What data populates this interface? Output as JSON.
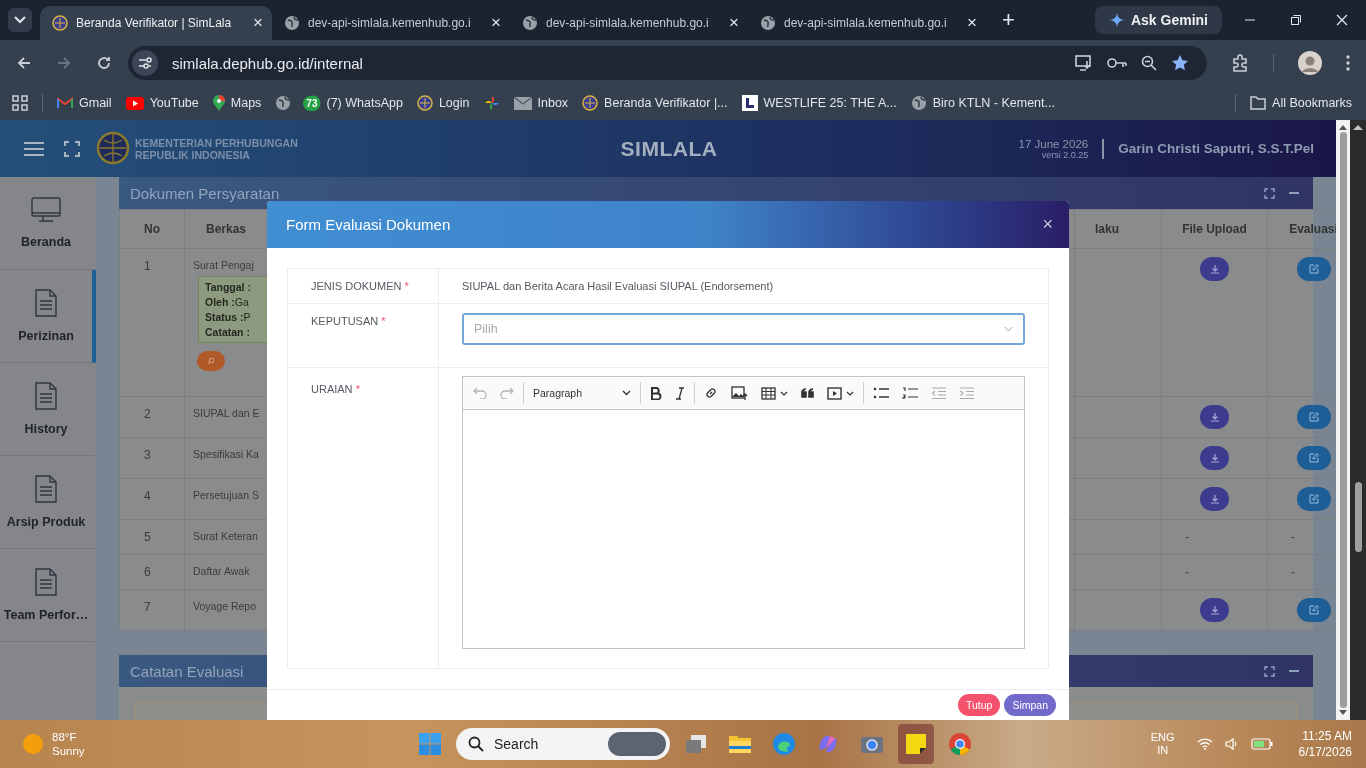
{
  "browser": {
    "tabs": [
      {
        "title": "Beranda Verifikator | SimLala",
        "selected": true,
        "close": "×"
      },
      {
        "title": "dev-api-simlala.kemenhub.go.i",
        "selected": false,
        "close": "×"
      },
      {
        "title": "dev-api-simlala.kemenhub.go.i",
        "selected": false,
        "close": "×"
      },
      {
        "title": "dev-api-simlala.kemenhub.go.i",
        "selected": false,
        "close": "×"
      }
    ],
    "new_tab": "+",
    "gemini": "Ask Gemini",
    "url": "simlala.dephub.go.id/internal",
    "bookmarks": [
      {
        "kind": "link",
        "label": "Gmail"
      },
      {
        "kind": "link",
        "label": "YouTube"
      },
      {
        "kind": "link",
        "label": "Maps"
      },
      {
        "kind": "icon"
      },
      {
        "kind": "link",
        "label": "(7) WhatsApp",
        "badge": "73"
      },
      {
        "kind": "link",
        "label": "Login"
      },
      {
        "kind": "icon"
      },
      {
        "kind": "link",
        "label": "Inbox"
      },
      {
        "kind": "link",
        "label": "Beranda Verifikator |..."
      },
      {
        "kind": "link",
        "label": "WESTLIFE 25: THE A..."
      },
      {
        "kind": "link",
        "label": "Biro KTLN - Kement..."
      }
    ],
    "all_bookmarks": "All Bookmarks"
  },
  "app": {
    "org_line1": "KEMENTERIAN PERHUBUNGAN",
    "org_line2": "REPUBLIK INDONESIA",
    "title": "SIMLALA",
    "date": "17 June 2026",
    "version": "versi 2.0.25",
    "user": "Garin Christi Saputri, S.S.T.Pel",
    "sidebar": [
      {
        "label": "Beranda",
        "selected": false
      },
      {
        "label": "Perizinan",
        "selected": true
      },
      {
        "label": "History",
        "selected": false
      },
      {
        "label": "Arsip Produk",
        "selected": false
      },
      {
        "label": "Team Perfor…",
        "selected": false
      }
    ],
    "documents": {
      "title": "Dokumen Persyaratan",
      "columns": [
        "No",
        "Berkas",
        "laku",
        "File Upload",
        "Evaluasi"
      ],
      "rows": [
        {
          "no": "1",
          "berkas": "Surat Pengaj",
          "note": [
            {
              "label": "Tanggal :"
            },
            {
              "label": "Oleh :",
              "value": "Ga"
            },
            {
              "label": "Status :",
              "value": "P"
            },
            {
              "label": "Catatan :"
            }
          ],
          "search": true,
          "file_upload": {
            "kind": "download"
          },
          "evaluasi": {
            "kind": "edit"
          }
        },
        {
          "no": "2",
          "berkas": "SIUPAL dan E",
          "file_upload": {
            "kind": "download"
          },
          "evaluasi": {
            "kind": "edit"
          }
        },
        {
          "no": "3",
          "berkas": "Spesifikasi Ka",
          "file_upload": {
            "kind": "download"
          },
          "evaluasi": {
            "kind": "edit"
          }
        },
        {
          "no": "4",
          "berkas": "Persetujuan S",
          "file_upload": {
            "kind": "download"
          },
          "evaluasi": {
            "kind": "edit"
          }
        },
        {
          "no": "5",
          "berkas": "Surat Keteran",
          "file_upload": {
            "kind": "text",
            "text": "-"
          },
          "evaluasi": {
            "kind": "text",
            "text": "-"
          }
        },
        {
          "no": "6",
          "berkas": "Daftar Awak",
          "file_upload": {
            "kind": "text",
            "text": "-"
          },
          "evaluasi": {
            "kind": "text",
            "text": "-"
          }
        },
        {
          "no": "7",
          "berkas": "Voyage Repo",
          "file_upload": {
            "kind": "download"
          },
          "evaluasi": {
            "kind": "edit"
          }
        }
      ]
    },
    "evaluation": {
      "title": "Catatan Evaluasi"
    }
  },
  "modal": {
    "title": "Form Evaluasi Dokumen",
    "close": "×",
    "fields": [
      {
        "kind": "text",
        "label": "JENIS DOKUMEN",
        "required_mark": "*",
        "value": "SIUPAL dan Berita Acara Hasil Evaluasi SIUPAL (Endorsement)"
      },
      {
        "kind": "select",
        "label": "KEPUTUSAN",
        "required_mark": "*",
        "placeholder": "Pilih",
        "focused": true
      },
      {
        "kind": "editor",
        "label": "URAIAN",
        "required_mark": "*",
        "block_format": "Paragraph"
      }
    ],
    "buttons": [
      {
        "label": "Tutup",
        "kind": "cancel"
      },
      {
        "label": "Simpan",
        "kind": "save"
      }
    ]
  },
  "taskbar": {
    "temperature": "88°F",
    "condition": "Sunny",
    "search": "Search",
    "language": "ENG",
    "region": "IN",
    "time": "11:25 AM",
    "date": "6/17/2026",
    "apps": [
      {
        "selected": false
      },
      {
        "selected": false
      },
      {
        "selected": false
      },
      {
        "selected": false
      },
      {
        "selected": false
      },
      {
        "selected": true
      },
      {
        "selected": false
      }
    ]
  }
}
